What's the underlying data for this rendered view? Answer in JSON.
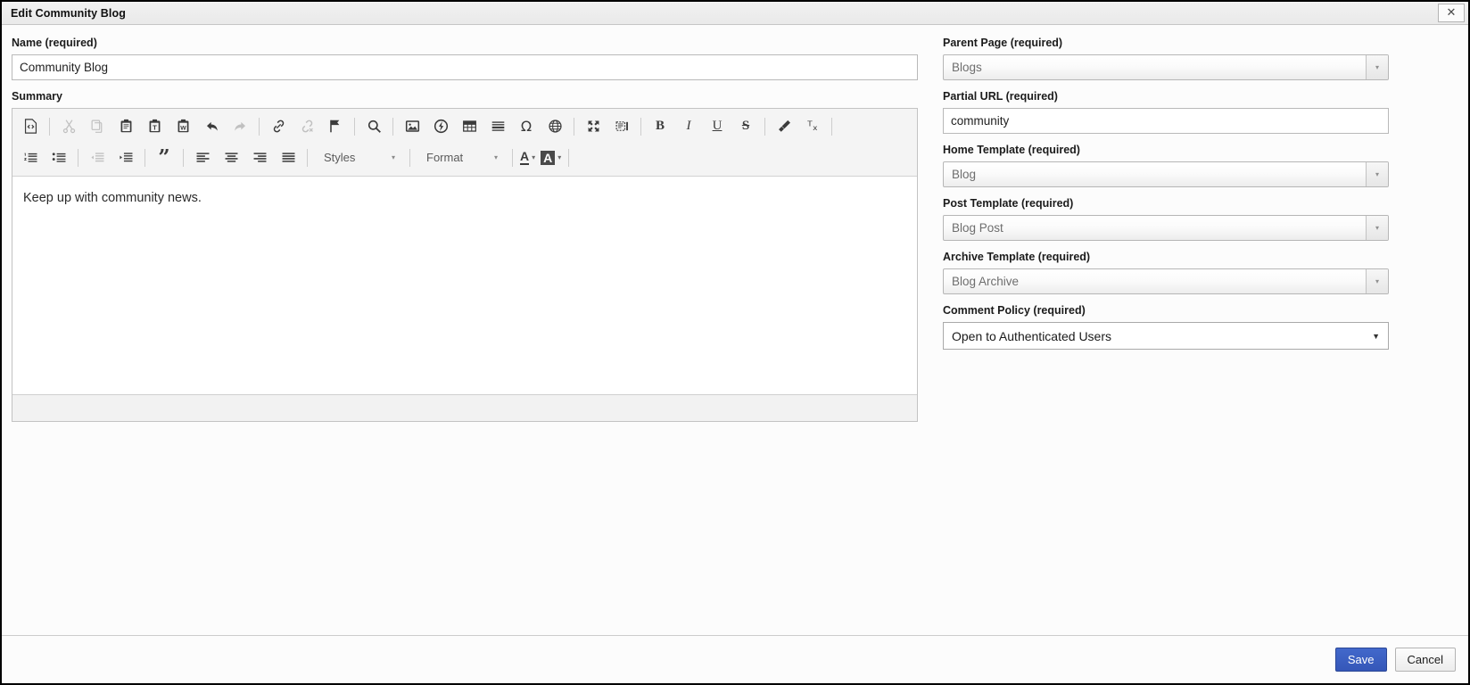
{
  "window": {
    "title": "Edit Community Blog",
    "close_label": "✕"
  },
  "left": {
    "name_label": "Name (required)",
    "name_value": "Community Blog",
    "name_placeholder": "",
    "summary_label": "Summary",
    "summary_body": "Keep up with community news."
  },
  "editor": {
    "row1": [
      {
        "name": "source-icon",
        "glyph": "source",
        "disabled": false
      },
      {
        "name": "separator",
        "glyph": "sep",
        "disabled": false
      },
      {
        "name": "cut-icon",
        "glyph": "cut",
        "disabled": true
      },
      {
        "name": "copy-icon",
        "glyph": "copy",
        "disabled": true
      },
      {
        "name": "paste-icon",
        "glyph": "paste",
        "disabled": false
      },
      {
        "name": "paste-as-plain-text-icon",
        "glyph": "paste-text",
        "disabled": false
      },
      {
        "name": "paste-from-word-icon",
        "glyph": "paste-word",
        "disabled": false
      },
      {
        "name": "undo-icon",
        "glyph": "undo",
        "disabled": false
      },
      {
        "name": "redo-icon",
        "glyph": "redo",
        "disabled": true
      },
      {
        "name": "separator",
        "glyph": "sep",
        "disabled": false
      },
      {
        "name": "link-icon",
        "glyph": "link",
        "disabled": false
      },
      {
        "name": "unlink-icon",
        "glyph": "unlink",
        "disabled": true
      },
      {
        "name": "anchor-icon",
        "glyph": "anchor",
        "disabled": false
      },
      {
        "name": "separator",
        "glyph": "sep",
        "disabled": false
      },
      {
        "name": "find-icon",
        "glyph": "find",
        "disabled": false
      },
      {
        "name": "separator",
        "glyph": "sep",
        "disabled": false
      },
      {
        "name": "image-icon",
        "glyph": "image",
        "disabled": false
      },
      {
        "name": "flash-icon",
        "glyph": "flash",
        "disabled": false
      },
      {
        "name": "table-icon",
        "glyph": "table",
        "disabled": false
      },
      {
        "name": "horizontal-rule-icon",
        "glyph": "hrule",
        "disabled": false
      },
      {
        "name": "special-character-icon",
        "glyph": "omega",
        "disabled": false
      },
      {
        "name": "iframe-icon",
        "glyph": "globe",
        "disabled": false
      },
      {
        "name": "separator",
        "glyph": "sep",
        "disabled": false
      },
      {
        "name": "maximize-icon",
        "glyph": "maximize",
        "disabled": false
      },
      {
        "name": "show-blocks-icon",
        "glyph": "showblocks",
        "disabled": false
      },
      {
        "name": "separator",
        "glyph": "sep",
        "disabled": false
      },
      {
        "name": "bold-icon",
        "glyph": "bold",
        "disabled": false
      },
      {
        "name": "italic-icon",
        "glyph": "italic",
        "disabled": false
      },
      {
        "name": "underline-icon",
        "glyph": "underline",
        "disabled": false
      },
      {
        "name": "strikethrough-icon",
        "glyph": "strike",
        "disabled": false
      },
      {
        "name": "separator",
        "glyph": "sep",
        "disabled": false
      },
      {
        "name": "copy-formatting-icon",
        "glyph": "brush",
        "disabled": false
      },
      {
        "name": "remove-format-icon",
        "glyph": "removeformat",
        "disabled": false
      },
      {
        "name": "separator",
        "glyph": "sep",
        "disabled": false
      }
    ],
    "row2": [
      {
        "name": "numbered-list-icon",
        "glyph": "numlist",
        "disabled": false
      },
      {
        "name": "bulleted-list-icon",
        "glyph": "bullist",
        "disabled": false
      },
      {
        "name": "separator",
        "glyph": "sep",
        "disabled": false
      },
      {
        "name": "decrease-indent-icon",
        "glyph": "outdent",
        "disabled": true
      },
      {
        "name": "increase-indent-icon",
        "glyph": "indent",
        "disabled": false
      },
      {
        "name": "separator",
        "glyph": "sep",
        "disabled": false
      },
      {
        "name": "block-quote-icon",
        "glyph": "quote",
        "disabled": false
      },
      {
        "name": "separator",
        "glyph": "sep",
        "disabled": false
      },
      {
        "name": "align-left-icon",
        "glyph": "alignleft",
        "disabled": false
      },
      {
        "name": "align-center-icon",
        "glyph": "aligncenter",
        "disabled": false
      },
      {
        "name": "align-right-icon",
        "glyph": "alignright",
        "disabled": false
      },
      {
        "name": "justify-icon",
        "glyph": "justify",
        "disabled": false
      },
      {
        "name": "separator",
        "glyph": "sep",
        "disabled": false
      }
    ],
    "styles_label": "Styles",
    "format_label": "Format",
    "text_color_label": "A",
    "bg_color_label": "A",
    "combo_arrow": "▾"
  },
  "right": {
    "fields": [
      {
        "label": "Parent Page (required)",
        "value": "Blogs",
        "type": "select-disabled"
      },
      {
        "label": "Partial URL (required)",
        "value": "community",
        "type": "text"
      },
      {
        "label": "Home Template (required)",
        "value": "Blog",
        "type": "select-disabled"
      },
      {
        "label": "Post Template (required)",
        "value": "Blog Post",
        "type": "select-disabled"
      },
      {
        "label": "Archive Template (required)",
        "value": "Blog Archive",
        "type": "select-disabled"
      },
      {
        "label": "Comment Policy (required)",
        "value": "Open to Authenticated Users",
        "type": "select-enabled"
      }
    ],
    "arrow": "▾",
    "arrow_plain": "▼"
  },
  "footer": {
    "save_label": "Save",
    "cancel_label": "Cancel"
  }
}
